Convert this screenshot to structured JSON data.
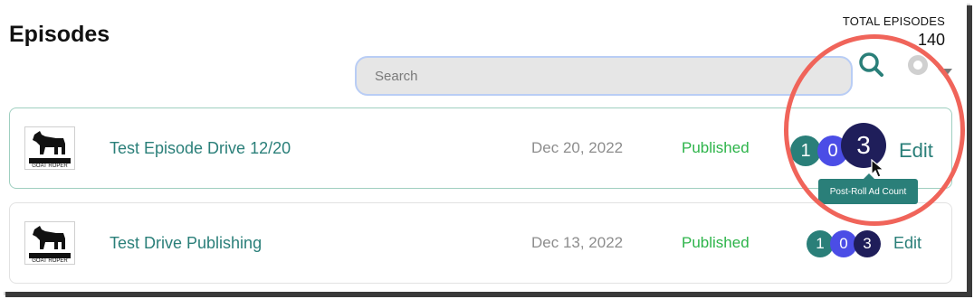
{
  "page": {
    "title": "Episodes"
  },
  "total": {
    "label": "TOTAL EPISODES",
    "value": "140"
  },
  "search": {
    "placeholder": "Search"
  },
  "episodes": [
    {
      "title": "Test Episode Drive 12/20",
      "date": "Dec 20, 2022",
      "status": "Published",
      "counts": {
        "pre_roll": "1",
        "mid_roll": "0",
        "post_roll": "3"
      },
      "edit_label": "Edit",
      "thumbnail_text": "GOAT ROPER"
    },
    {
      "title": "Test Drive Publishing",
      "date": "Dec 13, 2022",
      "status": "Published",
      "counts": {
        "pre_roll": "1",
        "mid_roll": "0",
        "post_roll": "3"
      },
      "edit_label": "Edit",
      "thumbnail_text": "GOAT ROPER"
    }
  ],
  "tooltip": {
    "text": "Post-Roll Ad Count"
  },
  "colors": {
    "teal": "#2a7f79",
    "published_green": "#2db44a",
    "badge_pre": "#2a7f79",
    "badge_mid": "#4b4de6",
    "badge_post": "#1f1e5a",
    "highlight_red": "#f0645a"
  },
  "icons": [
    "search-icon",
    "filter-icon",
    "goat-logo-icon",
    "mouse-cursor-icon"
  ]
}
